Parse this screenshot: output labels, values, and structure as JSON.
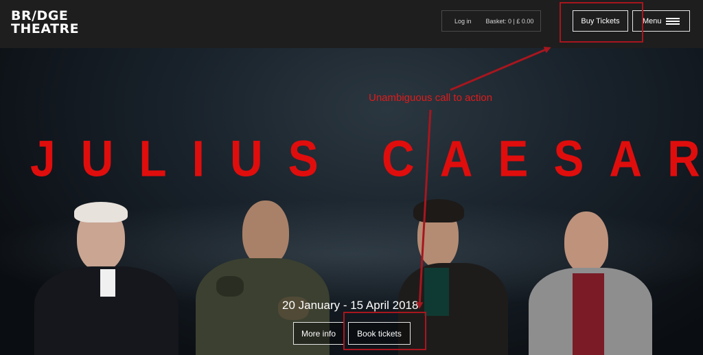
{
  "header": {
    "logo_line1": "BR/DGE",
    "logo_line2": "THEATRE",
    "login_label": "Log in",
    "basket_label": "Basket: 0 | £ 0.00",
    "buy_tickets_label": "Buy Tickets",
    "menu_label": "Menu"
  },
  "hero": {
    "title": "JULIUS CAESAR",
    "dates": "20 January - 15 April 2018",
    "more_info_label": "More info",
    "book_tickets_label": "Book tickets"
  },
  "annotation": {
    "label": "Unambiguous call to action",
    "color": "#e11b1b"
  },
  "colors": {
    "header_bg": "#1e1e1e",
    "title_red": "#e00d0d",
    "highlight": "#a8161e"
  },
  "icons": [
    "hamburger-menu-icon"
  ]
}
